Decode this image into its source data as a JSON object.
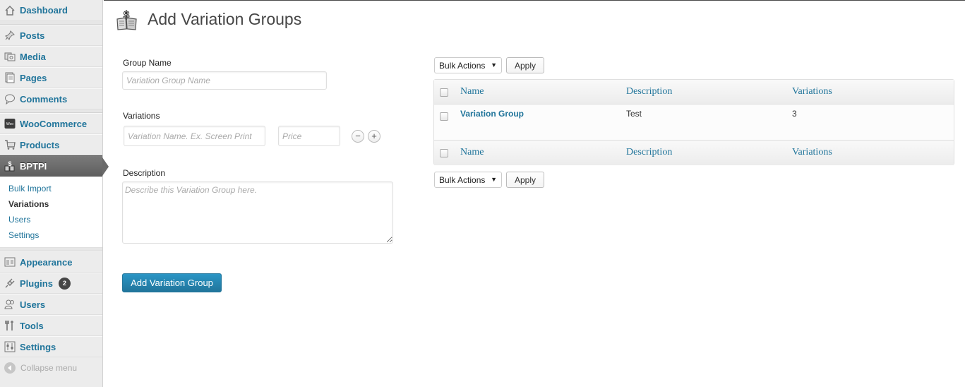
{
  "sidebar": {
    "dashboard": "Dashboard",
    "posts": "Posts",
    "media": "Media",
    "pages": "Pages",
    "comments": "Comments",
    "woocommerce": "WooCommerce",
    "products": "Products",
    "bptpi": "BPTPI",
    "submenu": [
      "Bulk Import",
      "Variations",
      "Users",
      "Settings"
    ],
    "appearance": "Appearance",
    "plugins": "Plugins",
    "plugins_badge": "2",
    "users": "Users",
    "tools": "Tools",
    "settings": "Settings",
    "collapse": "Collapse menu"
  },
  "page": {
    "title": "Add Variation Groups"
  },
  "form": {
    "group_name_label": "Group Name",
    "group_name_placeholder": "Variation Group Name",
    "variations_label": "Variations",
    "variation_name_placeholder": "Variation Name. Ex. Screen Print",
    "price_placeholder": "Price",
    "remove_symbol": "−",
    "add_symbol": "+",
    "description_label": "Description",
    "description_placeholder": "Describe this Variation Group here.",
    "submit_label": "Add Variation Group"
  },
  "table": {
    "bulk_actions_label": "Bulk Actions",
    "apply_label": "Apply",
    "columns": [
      "Name",
      "Description",
      "Variations"
    ],
    "rows": [
      {
        "name": "Variation Group",
        "description": "Test",
        "variations": "3"
      }
    ]
  },
  "colors": {
    "link": "#21759b",
    "primary_button": "#21759b",
    "sidebar_bg": "#ececec"
  }
}
